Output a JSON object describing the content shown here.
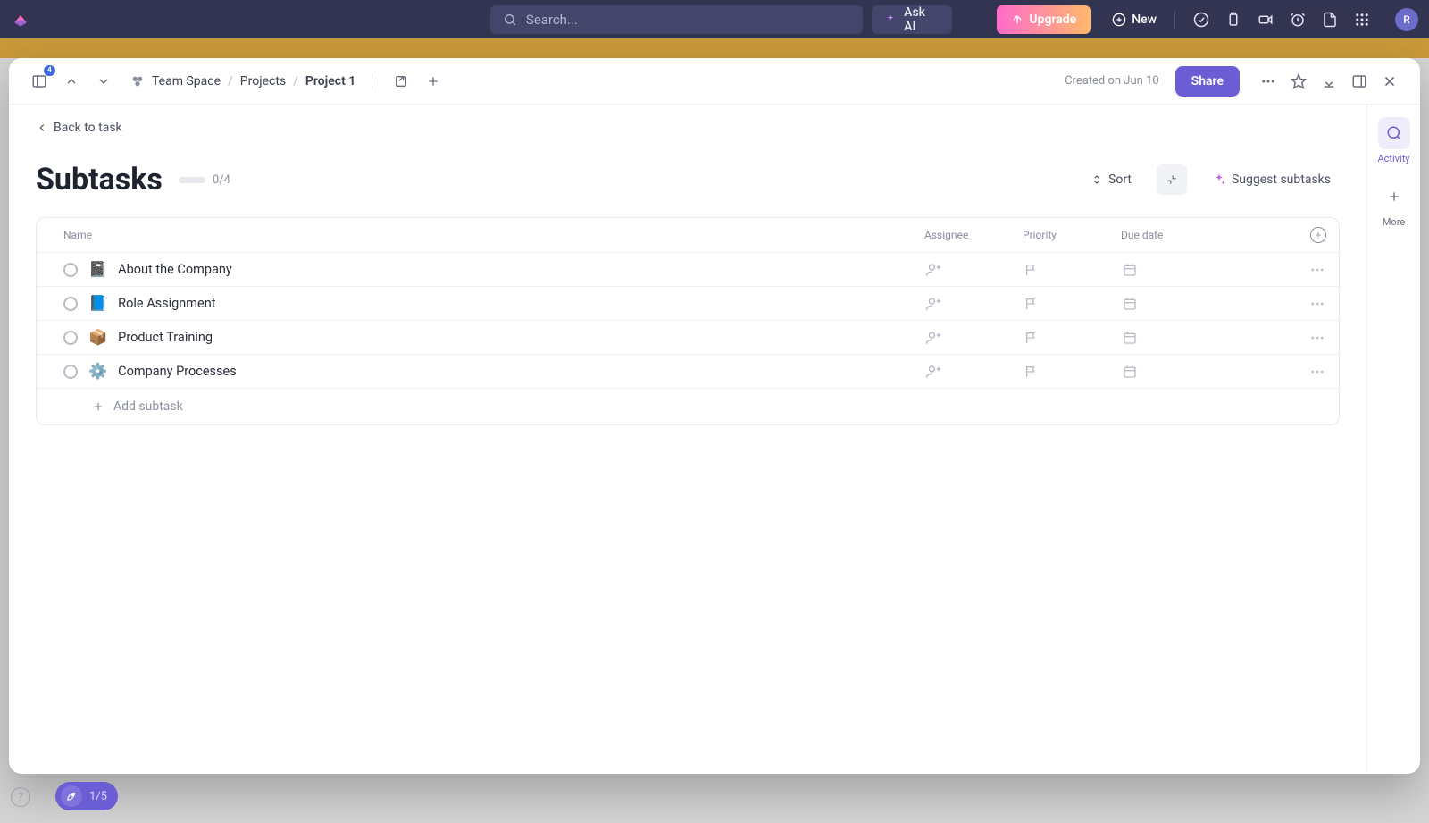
{
  "topbar": {
    "search_placeholder": "Search...",
    "ask_ai_label": "Ask AI",
    "upgrade_label": "Upgrade",
    "new_label": "New",
    "avatar_initial": "R"
  },
  "modal": {
    "sidebar_badge": "4",
    "breadcrumbs": [
      {
        "label": "Team Space",
        "active": false
      },
      {
        "label": "Projects",
        "active": false
      },
      {
        "label": "Project 1",
        "active": true
      }
    ],
    "created_on": "Created on Jun 10",
    "share_label": "Share",
    "back_label": "Back to task",
    "title": "Subtasks",
    "progress_text": "0/4",
    "sort_label": "Sort",
    "suggest_label": "Suggest subtasks",
    "columns": {
      "name": "Name",
      "assignee": "Assignee",
      "priority": "Priority",
      "due": "Due date"
    },
    "rows": [
      {
        "emoji": "📓",
        "name": "About the Company"
      },
      {
        "emoji": "📘",
        "name": "Role Assignment"
      },
      {
        "emoji": "📦",
        "name": "Product Training"
      },
      {
        "emoji": "⚙️",
        "name": "Company Processes"
      }
    ],
    "add_subtask_label": "Add subtask",
    "rail": {
      "activity_label": "Activity",
      "more_label": "More"
    }
  },
  "footer": {
    "onboarding_progress": "1/5"
  },
  "colors": {
    "accent": "#6b5dd3",
    "topbar": "#323452",
    "upgrade_grad_from": "#ff6bcb",
    "upgrade_grad_to": "#ffb86b"
  }
}
